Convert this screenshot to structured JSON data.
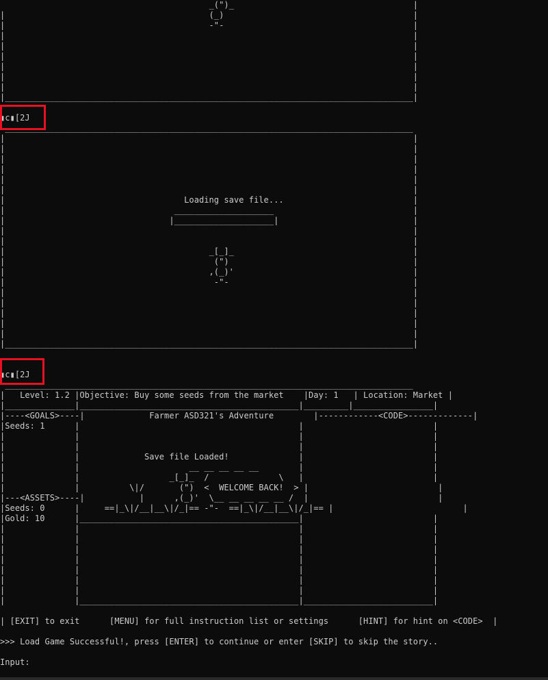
{
  "terminal_lines": [
    "                                          _(\")_                                    |",
    "|                                         (_)                                      |",
    "|                                         -\"-                                      |",
    "|                                                                                  |",
    "|                                                                                  |",
    "|                                                                                  |",
    "|                                                                                  |",
    "|                                                                                  |",
    "|                                                                                  |",
    "|__________________________________________________________________________________|",
    "",
    "▮c▮[2J",
    " __________________________________________________________________________________ ",
    "|                                                                                  |",
    "|                                                                                  |",
    "|                                                                                  |",
    "|                                                                                  |",
    "|                                                                                  |",
    "|                                                                                  |",
    "|                                    Loading save file...                          |",
    "|                                  ____________________                            |",
    "|                                 |____________________|                           |",
    "|                                                                                  |",
    "|                                                                                  |",
    "|                                         _[_]_                                    |",
    "|                                          (\")                                     |",
    "|                                         ,(_)'                                    |",
    "|                                          -\"-                                     |",
    "|                                                                                  |",
    "|                                                                                  |",
    "|                                                                                  |",
    "|                                                                                  |",
    "|                                                                                  |",
    "|__________________________________________________________________________________|",
    "",
    "▮c▮[2J",
    " __________________________________________________________________________________ ",
    "|   Level: 1.2 |Objective: Buy some seeds from the market    |Day: 1   | Location: Market |",
    "|______________|____________________________________________|_________|________________|",
    "|----<GOALS>----|             Farmer ASD321's Adventure        |------------<CODE>-------------|",
    "|Seeds: 1      |                                            |                          |",
    "|              |                                            |                          |",
    "|              |                                            |                          |",
    "|              |             Save file Loaded!              |                          |",
    "|              |                      __ __ __ __ __        |                          |",
    "|              |                  _[_]_  /              \\   |                          |",
    "|              |          \\|/       (\")  <  WELCOME BACK!  > |                          |",
    "|---<ASSETS>----|           |      ,(_)'  \\__ __ __ __ __ /  |                          |",
    "|Seeds: 0      |     ==|_\\|/__|__\\|/_|== -\"-  ==|_\\|/__|__\\|/_|== |                          |",
    "|Gold: 10      |____________________________________________|                          |",
    "|              |                                            |                          |",
    "|              |                                            |                          |",
    "|              |                                            |                          |",
    "|              |                                            |                          |",
    "|              |                                            |                          |",
    "|              |                                            |                          |",
    "|              |                                            |                          |",
    "|              |____________________________________________|__________________________|",
    "| [EXIT] to exit      [MENU] for full instruction list or settings      [HINT] for hint on <CODE>  |",
    "",
    ">>> Load Game Successful!, press [ENTER] to continue or enter [SKIP] to skip the story..",
    "",
    "Input:",
    ""
  ],
  "accent_color": "#e81123",
  "text_color": "#cccccc",
  "background_color": "#0c0c0c"
}
